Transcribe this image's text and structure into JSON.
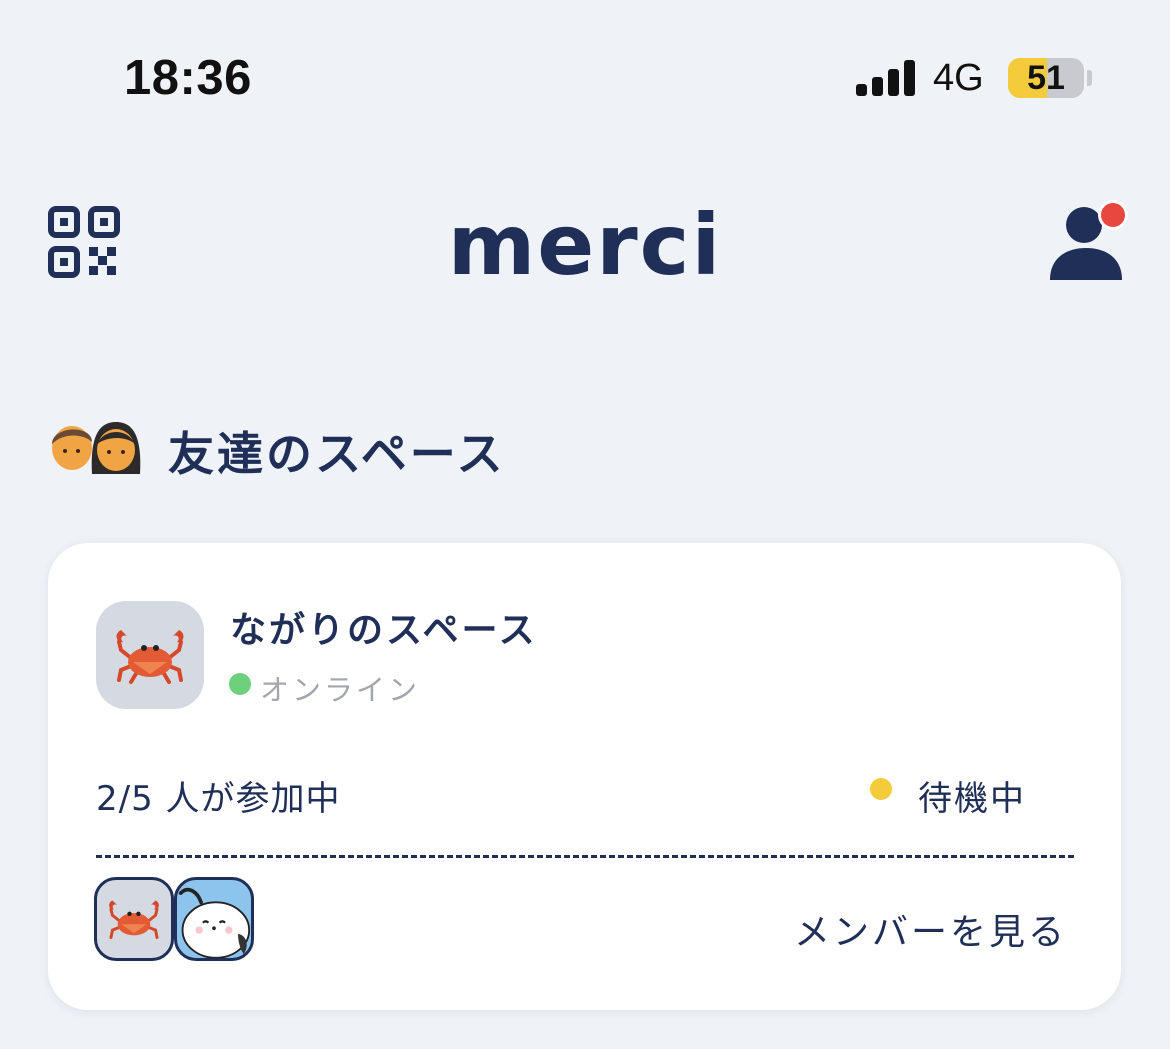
{
  "status_bar": {
    "time": "18:36",
    "network": "4G",
    "battery_level": "51",
    "battery_fraction": 0.51,
    "signal_bars": 4
  },
  "header": {
    "app_title": "merci",
    "left_icon": "qr-code-icon",
    "right_icon": "profile-icon",
    "notification_color": "#e8473d"
  },
  "section": {
    "icon": "two-people-icon",
    "title": "友達のスペース"
  },
  "card": {
    "avatar_icon": "crab-icon",
    "name": "ながりのスペース",
    "status": "オンライン",
    "status_color": "#6dd07d",
    "participants": "2/5 人が参加中",
    "state": "待機中",
    "state_color": "#f4cb3a",
    "members": [
      {
        "icon": "crab-icon"
      },
      {
        "icon": "white-bird-icon"
      }
    ],
    "view_members": "メンバーを見る"
  },
  "colors": {
    "background": "#eff2f7",
    "primary_text": "#1f2f57",
    "card": "#ffffff"
  }
}
